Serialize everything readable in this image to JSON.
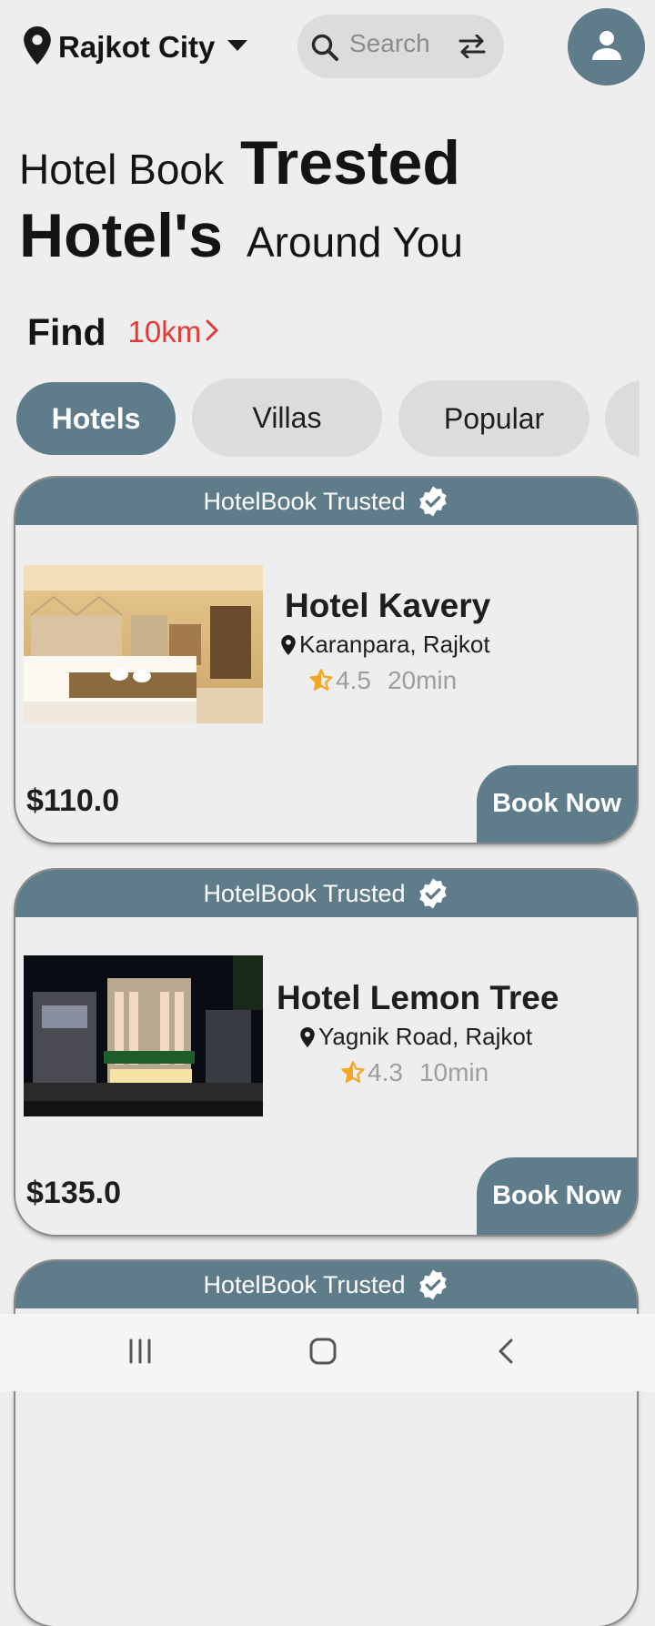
{
  "header": {
    "location": "Rajkot City",
    "search_placeholder": "Search"
  },
  "headline": {
    "part1": "Hotel Book",
    "part2": "Trested",
    "part3": "Hotel's",
    "part4": "Around You"
  },
  "find": {
    "label": "Find",
    "distance": "10km"
  },
  "tabs": [
    {
      "label": "Hotels",
      "active": true
    },
    {
      "label": "Villas",
      "active": false
    },
    {
      "label": "Popular",
      "active": false
    }
  ],
  "cards": [
    {
      "trusted_label": "HotelBook Trusted",
      "name": "Hotel Kavery",
      "address": "Karanpara, Rajkot",
      "rating": "4.5",
      "eta": "20min",
      "price": "$110.0",
      "button": "Book Now"
    },
    {
      "trusted_label": "HotelBook Trusted",
      "name": "Hotel Lemon Tree",
      "address": "Yagnik Road, Rajkot",
      "rating": "4.3",
      "eta": "10min",
      "price": "$135.0",
      "button": "Book Now"
    },
    {
      "trusted_label": "HotelBook Trusted"
    }
  ],
  "colors": {
    "accent": "#5f7c8a",
    "distance": "#e53935",
    "star": "#f5a623",
    "background": "#eeeeee"
  },
  "icons": {
    "location": "location-pin-icon",
    "dropdown": "caret-down-icon",
    "search": "search-icon",
    "filter": "swap-arrows-icon",
    "avatar": "person-icon",
    "verified": "verified-badge-icon",
    "star": "star-half-icon",
    "nav": [
      "recent-apps-icon",
      "home-icon",
      "back-icon"
    ]
  }
}
